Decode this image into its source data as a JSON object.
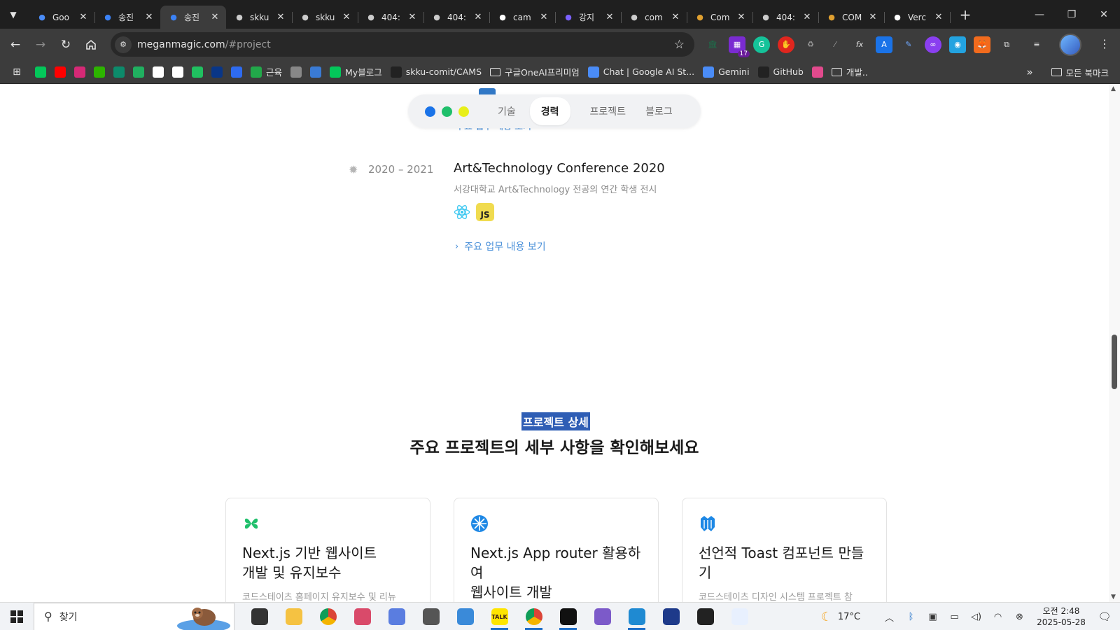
{
  "browser": {
    "tabs": [
      {
        "title": "Goo",
        "favicon": "gemini-icon",
        "color": "#4a8cf7",
        "active": false
      },
      {
        "title": "송진",
        "favicon": "vercel-like-icon",
        "color": "#3b82f6",
        "active": false
      },
      {
        "title": "송진",
        "favicon": "vercel-like-icon",
        "color": "#3b82f6",
        "active": true
      },
      {
        "title": "skku",
        "favicon": "github-icon",
        "color": "#cccccc",
        "active": false
      },
      {
        "title": "skku",
        "favicon": "github-icon",
        "color": "#cccccc",
        "active": false
      },
      {
        "title": "404:",
        "favicon": "globe-icon",
        "color": "#cccccc",
        "active": false
      },
      {
        "title": "404:",
        "favicon": "globe-icon",
        "color": "#cccccc",
        "active": false
      },
      {
        "title": "cam",
        "favicon": "vercel-icon",
        "color": "#ffffff",
        "active": false
      },
      {
        "title": "강지",
        "favicon": "yahoo-icon",
        "color": "#7b61ff",
        "active": false
      },
      {
        "title": "com",
        "favicon": "globe-icon",
        "color": "#cccccc",
        "active": false
      },
      {
        "title": "Com",
        "favicon": "cube-icon",
        "color": "#e0a030",
        "active": false
      },
      {
        "title": "404:",
        "favicon": "globe-icon",
        "color": "#cccccc",
        "active": false
      },
      {
        "title": "COM",
        "favicon": "cube-icon",
        "color": "#e0a030",
        "active": false
      },
      {
        "title": "Verc",
        "favicon": "vercel-icon",
        "color": "#ffffff",
        "active": false
      }
    ],
    "url_host": "meganmagic.com",
    "url_path": "/#project",
    "extension_badge": "17",
    "bookmarks": [
      {
        "label": "",
        "icon": "naver-icon",
        "color": "#03c75a"
      },
      {
        "label": "",
        "icon": "youtube-icon",
        "color": "#ff0000"
      },
      {
        "label": "",
        "icon": "instagram-icon",
        "color": "#d62976"
      },
      {
        "label": "",
        "icon": "catchtable-icon",
        "color": "#2db400"
      },
      {
        "label": "",
        "icon": "edge-icon",
        "color": "#0c8b6b"
      },
      {
        "label": "",
        "icon": "feather-icon",
        "color": "#20b060"
      },
      {
        "label": "",
        "icon": "notion-icon",
        "color": "#ffffff"
      },
      {
        "label": "",
        "icon": "threads-icon",
        "color": "#ffffff"
      },
      {
        "label": "",
        "icon": "chat-icon",
        "color": "#20c060"
      },
      {
        "label": "",
        "icon": "upbit-icon",
        "color": "#093687"
      },
      {
        "label": "",
        "icon": "diamond-icon",
        "color": "#2e6bf0"
      },
      {
        "label": "근육",
        "icon": "leaf-icon",
        "color": "#22a84a"
      },
      {
        "label": "",
        "icon": "globe-icon",
        "color": "#888888"
      },
      {
        "label": "",
        "icon": "c-icon",
        "color": "#3a7bd5"
      },
      {
        "label": "My블로그",
        "icon": "blog-icon",
        "color": "#03c75a"
      },
      {
        "label": "skku-comit/CAMS",
        "icon": "github-icon",
        "color": "#222222"
      },
      {
        "label": "구글OneAI프리미엄",
        "icon": "folder-icon",
        "color": "#e3e3e3"
      },
      {
        "label": "Chat | Google AI St...",
        "icon": "aistudio-icon",
        "color": "#4a8cf7"
      },
      {
        "label": "Gemini",
        "icon": "gemini-icon",
        "color": "#4a8cf7"
      },
      {
        "label": "GitHub",
        "icon": "github-icon",
        "color": "#222222"
      },
      {
        "label": "",
        "icon": "pinwheel-icon",
        "color": "#e24a8d"
      },
      {
        "label": "개발..",
        "icon": "folder-icon",
        "color": "#e3e3e3"
      }
    ],
    "all_bookmarks_label": "모든 북마크"
  },
  "site": {
    "nav": {
      "dots": [
        "#1a73e8",
        "#1fbf6b",
        "#e8ef1a"
      ],
      "links": [
        {
          "label": "기술",
          "active": false
        },
        {
          "label": "경력",
          "active": true
        },
        {
          "label": "프로젝트",
          "active": false
        },
        {
          "label": "블로그",
          "active": false
        }
      ]
    },
    "residue_link": "주요 업무 내용 보기",
    "career": {
      "period": "2020 – 2021",
      "title": "Art&Technology Conference 2020",
      "description": "서강대학교 Art&Technology 전공의 연간 학생 전시",
      "techs": [
        "react-icon",
        "JS"
      ],
      "details_link": "주요 업무 내용 보기"
    },
    "projects_section": {
      "label": "프로젝트 상세",
      "heading": "주요 프로젝트의 세부 사항을 확인해보세요"
    },
    "projects": [
      {
        "title_line1": "Next.js 기반 웹사이트",
        "title_line2": "개발 및 유지보수",
        "title_line3": "",
        "desc": "코드스테이츠 홈페이지 유지보수 및 리뉴",
        "logo": "clover-icon",
        "color": "#1fbf6b"
      },
      {
        "title_line1": "Next.js App router 활용하",
        "title_line2": "여",
        "title_line3": "웹사이트 개발",
        "desc": "",
        "logo": "snowflake-icon",
        "color": "#1e88e5"
      },
      {
        "title_line1": "선언적 Toast 컴포넌트 만들",
        "title_line2": "기",
        "title_line3": "",
        "desc": "코드스테이츠 디자인 시스템 프로젝트 참",
        "logo": "triple-drop-icon",
        "color": "#1e88e5"
      }
    ]
  },
  "taskbar": {
    "search_placeholder": "찾기",
    "weather": "17°C",
    "time": "오전 2:48",
    "date": "2025-05-28",
    "kakao_label": "TALK",
    "apps": [
      {
        "name": "task-view-icon",
        "color": "#333333",
        "running": false
      },
      {
        "name": "file-explorer-icon",
        "color": "#f5c242",
        "running": false
      },
      {
        "name": "chrome-icon",
        "color": "#db4437",
        "running": false
      },
      {
        "name": "snipping-tool-icon",
        "color": "#d94a6a",
        "running": false
      },
      {
        "name": "app-settings-blue-icon",
        "color": "#5a7de0",
        "running": false
      },
      {
        "name": "settings-icon",
        "color": "#555555",
        "running": false
      },
      {
        "name": "editor-icon",
        "color": "#3a8ad9",
        "running": false
      },
      {
        "name": "kakaotalk-icon",
        "color": "#fee500",
        "running": true
      },
      {
        "name": "chrome-icon",
        "color": "#db4437",
        "running": true
      },
      {
        "name": "notion-icon",
        "color": "#111111",
        "running": true
      },
      {
        "name": "github-desktop-icon",
        "color": "#7c5ac9",
        "running": false
      },
      {
        "name": "vscode-icon",
        "color": "#1f8ad2",
        "running": true
      },
      {
        "name": "app-circle-icon",
        "color": "#1e3a8a",
        "running": false
      },
      {
        "name": "terminal-icon",
        "color": "#222222",
        "running": false
      },
      {
        "name": "code-tag-icon",
        "color": "#e8f0fe",
        "running": false
      }
    ]
  }
}
